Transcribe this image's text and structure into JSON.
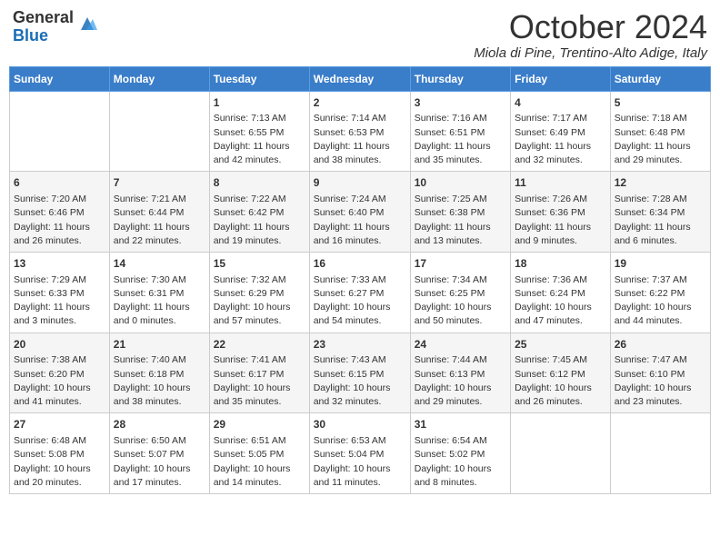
{
  "header": {
    "logo_general": "General",
    "logo_blue": "Blue",
    "month_title": "October 2024",
    "location": "Miola di Pine, Trentino-Alto Adige, Italy"
  },
  "days_of_week": [
    "Sunday",
    "Monday",
    "Tuesday",
    "Wednesday",
    "Thursday",
    "Friday",
    "Saturday"
  ],
  "weeks": [
    [
      {
        "day": "",
        "content": ""
      },
      {
        "day": "",
        "content": ""
      },
      {
        "day": "1",
        "content": "Sunrise: 7:13 AM\nSunset: 6:55 PM\nDaylight: 11 hours and 42 minutes."
      },
      {
        "day": "2",
        "content": "Sunrise: 7:14 AM\nSunset: 6:53 PM\nDaylight: 11 hours and 38 minutes."
      },
      {
        "day": "3",
        "content": "Sunrise: 7:16 AM\nSunset: 6:51 PM\nDaylight: 11 hours and 35 minutes."
      },
      {
        "day": "4",
        "content": "Sunrise: 7:17 AM\nSunset: 6:49 PM\nDaylight: 11 hours and 32 minutes."
      },
      {
        "day": "5",
        "content": "Sunrise: 7:18 AM\nSunset: 6:48 PM\nDaylight: 11 hours and 29 minutes."
      }
    ],
    [
      {
        "day": "6",
        "content": "Sunrise: 7:20 AM\nSunset: 6:46 PM\nDaylight: 11 hours and 26 minutes."
      },
      {
        "day": "7",
        "content": "Sunrise: 7:21 AM\nSunset: 6:44 PM\nDaylight: 11 hours and 22 minutes."
      },
      {
        "day": "8",
        "content": "Sunrise: 7:22 AM\nSunset: 6:42 PM\nDaylight: 11 hours and 19 minutes."
      },
      {
        "day": "9",
        "content": "Sunrise: 7:24 AM\nSunset: 6:40 PM\nDaylight: 11 hours and 16 minutes."
      },
      {
        "day": "10",
        "content": "Sunrise: 7:25 AM\nSunset: 6:38 PM\nDaylight: 11 hours and 13 minutes."
      },
      {
        "day": "11",
        "content": "Sunrise: 7:26 AM\nSunset: 6:36 PM\nDaylight: 11 hours and 9 minutes."
      },
      {
        "day": "12",
        "content": "Sunrise: 7:28 AM\nSunset: 6:34 PM\nDaylight: 11 hours and 6 minutes."
      }
    ],
    [
      {
        "day": "13",
        "content": "Sunrise: 7:29 AM\nSunset: 6:33 PM\nDaylight: 11 hours and 3 minutes."
      },
      {
        "day": "14",
        "content": "Sunrise: 7:30 AM\nSunset: 6:31 PM\nDaylight: 11 hours and 0 minutes."
      },
      {
        "day": "15",
        "content": "Sunrise: 7:32 AM\nSunset: 6:29 PM\nDaylight: 10 hours and 57 minutes."
      },
      {
        "day": "16",
        "content": "Sunrise: 7:33 AM\nSunset: 6:27 PM\nDaylight: 10 hours and 54 minutes."
      },
      {
        "day": "17",
        "content": "Sunrise: 7:34 AM\nSunset: 6:25 PM\nDaylight: 10 hours and 50 minutes."
      },
      {
        "day": "18",
        "content": "Sunrise: 7:36 AM\nSunset: 6:24 PM\nDaylight: 10 hours and 47 minutes."
      },
      {
        "day": "19",
        "content": "Sunrise: 7:37 AM\nSunset: 6:22 PM\nDaylight: 10 hours and 44 minutes."
      }
    ],
    [
      {
        "day": "20",
        "content": "Sunrise: 7:38 AM\nSunset: 6:20 PM\nDaylight: 10 hours and 41 minutes."
      },
      {
        "day": "21",
        "content": "Sunrise: 7:40 AM\nSunset: 6:18 PM\nDaylight: 10 hours and 38 minutes."
      },
      {
        "day": "22",
        "content": "Sunrise: 7:41 AM\nSunset: 6:17 PM\nDaylight: 10 hours and 35 minutes."
      },
      {
        "day": "23",
        "content": "Sunrise: 7:43 AM\nSunset: 6:15 PM\nDaylight: 10 hours and 32 minutes."
      },
      {
        "day": "24",
        "content": "Sunrise: 7:44 AM\nSunset: 6:13 PM\nDaylight: 10 hours and 29 minutes."
      },
      {
        "day": "25",
        "content": "Sunrise: 7:45 AM\nSunset: 6:12 PM\nDaylight: 10 hours and 26 minutes."
      },
      {
        "day": "26",
        "content": "Sunrise: 7:47 AM\nSunset: 6:10 PM\nDaylight: 10 hours and 23 minutes."
      }
    ],
    [
      {
        "day": "27",
        "content": "Sunrise: 6:48 AM\nSunset: 5:08 PM\nDaylight: 10 hours and 20 minutes."
      },
      {
        "day": "28",
        "content": "Sunrise: 6:50 AM\nSunset: 5:07 PM\nDaylight: 10 hours and 17 minutes."
      },
      {
        "day": "29",
        "content": "Sunrise: 6:51 AM\nSunset: 5:05 PM\nDaylight: 10 hours and 14 minutes."
      },
      {
        "day": "30",
        "content": "Sunrise: 6:53 AM\nSunset: 5:04 PM\nDaylight: 10 hours and 11 minutes."
      },
      {
        "day": "31",
        "content": "Sunrise: 6:54 AM\nSunset: 5:02 PM\nDaylight: 10 hours and 8 minutes."
      },
      {
        "day": "",
        "content": ""
      },
      {
        "day": "",
        "content": ""
      }
    ]
  ]
}
